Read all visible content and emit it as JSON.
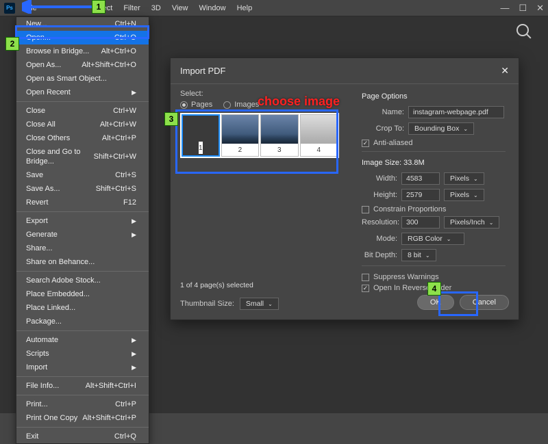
{
  "menu": {
    "items": [
      "File",
      "",
      "",
      "",
      "",
      "Select",
      "Filter",
      "3D",
      "View",
      "Window",
      "Help"
    ]
  },
  "file_menu": {
    "new": {
      "label": "New...",
      "shortcut": "Ctrl+N"
    },
    "open": {
      "label": "Open...",
      "shortcut": "Ctrl+O"
    },
    "browse": {
      "label": "Browse in Bridge...",
      "shortcut": "Alt+Ctrl+O"
    },
    "open_as": {
      "label": "Open As...",
      "shortcut": "Alt+Shift+Ctrl+O"
    },
    "open_smart": {
      "label": "Open as Smart Object..."
    },
    "open_recent": {
      "label": "Open Recent"
    },
    "close": {
      "label": "Close",
      "shortcut": "Ctrl+W"
    },
    "close_all": {
      "label": "Close All",
      "shortcut": "Alt+Ctrl+W"
    },
    "close_others": {
      "label": "Close Others",
      "shortcut": "Alt+Ctrl+P"
    },
    "close_bridge": {
      "label": "Close and Go to Bridge...",
      "shortcut": "Shift+Ctrl+W"
    },
    "save": {
      "label": "Save",
      "shortcut": "Ctrl+S"
    },
    "save_as": {
      "label": "Save As...",
      "shortcut": "Shift+Ctrl+S"
    },
    "revert": {
      "label": "Revert",
      "shortcut": "F12"
    },
    "export": {
      "label": "Export"
    },
    "generate": {
      "label": "Generate"
    },
    "share": {
      "label": "Share..."
    },
    "share_behance": {
      "label": "Share on Behance..."
    },
    "search_stock": {
      "label": "Search Adobe Stock..."
    },
    "place_embed": {
      "label": "Place Embedded..."
    },
    "place_link": {
      "label": "Place Linked..."
    },
    "package": {
      "label": "Package..."
    },
    "automate": {
      "label": "Automate"
    },
    "scripts": {
      "label": "Scripts"
    },
    "import": {
      "label": "Import"
    },
    "file_info": {
      "label": "File Info...",
      "shortcut": "Alt+Shift+Ctrl+I"
    },
    "print": {
      "label": "Print...",
      "shortcut": "Ctrl+P"
    },
    "print_one": {
      "label": "Print One Copy",
      "shortcut": "Alt+Shift+Ctrl+P"
    },
    "exit": {
      "label": "Exit",
      "shortcut": "Ctrl+Q"
    }
  },
  "dialog": {
    "title": "Import PDF",
    "select_label": "Select:",
    "pages": "Pages",
    "images": "Images",
    "thumbs": [
      "1",
      "2",
      "3",
      "4"
    ],
    "status": "1 of 4 page(s) selected",
    "thumb_size_label": "Thumbnail Size:",
    "thumb_size": "Small",
    "page_options": "Page Options",
    "name_label": "Name:",
    "name": "instagram-webpage.pdf",
    "crop_label": "Crop To:",
    "crop": "Bounding Box",
    "anti": "Anti-aliased",
    "size_hdr": "Image Size: 33.8M",
    "width_label": "Width:",
    "width": "4583",
    "height_label": "Height:",
    "height": "2579",
    "unit_px": "Pixels",
    "constrain": "Constrain Proportions",
    "res_label": "Resolution:",
    "res": "300",
    "res_unit": "Pixels/Inch",
    "mode_label": "Mode:",
    "mode": "RGB Color",
    "bit_label": "Bit Depth:",
    "bit": "8 bit",
    "suppress": "Suppress Warnings",
    "reverse": "Open In Reverse Order",
    "ok": "OK",
    "cancel": "Cancel"
  },
  "anno": {
    "choose": "choose image"
  }
}
